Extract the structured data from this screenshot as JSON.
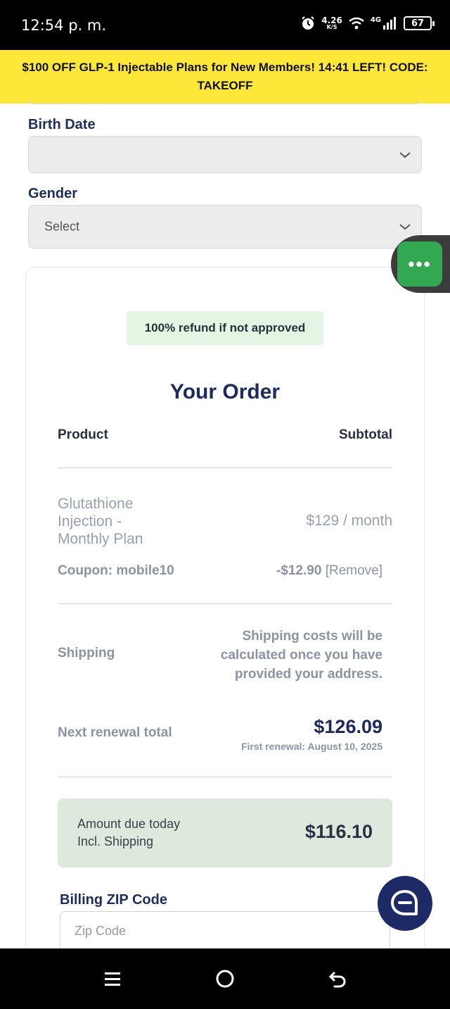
{
  "status_bar": {
    "time": "12:54 p. m.",
    "net_speed_value": "4.26",
    "net_speed_unit": "K/S",
    "network_type": "4G",
    "battery": "67"
  },
  "promo": {
    "text": "$100 OFF GLP-1 Injectable Plans for New Members! 14:41 LEFT! CODE: TAKEOFF"
  },
  "form": {
    "birth_date_label": "Birth Date",
    "birth_date_value": "",
    "gender_label": "Gender",
    "gender_value": "Select"
  },
  "order": {
    "refund_badge": "100% refund if not approved",
    "title": "Your Order",
    "col_product": "Product",
    "col_subtotal": "Subtotal",
    "product_name": "Glutathione Injection - Monthly Plan",
    "product_price": "$129 / month",
    "coupon_label": "Coupon: mobile10",
    "coupon_amount": "-$12.90",
    "coupon_remove": "[Remove]",
    "shipping_label": "Shipping",
    "shipping_note": "Shipping costs will be calculated once you have provided your address.",
    "renewal_label": "Next renewal total",
    "renewal_amount": "$126.09",
    "renewal_date": "First renewal: August 10, 2025",
    "amount_due_label_1": "Amount due today",
    "amount_due_label_2": "Incl. Shipping",
    "amount_due_value": "$116.10"
  },
  "billing": {
    "zip_label": "Billing ZIP Code",
    "zip_placeholder": "Zip Code",
    "zip_value": ""
  },
  "colors": {
    "promo_bg": "#fde83a",
    "title_navy": "#1c2a5e",
    "chat_green": "#33a852",
    "support_navy": "#1d2a66",
    "amount_box_bg": "#dde9dc"
  },
  "icons": {
    "chat_menu": "more-dots-icon",
    "support": "chat-bubble-icon",
    "nav_menu": "recent-apps-icon",
    "nav_home": "home-icon",
    "nav_back": "back-icon"
  }
}
